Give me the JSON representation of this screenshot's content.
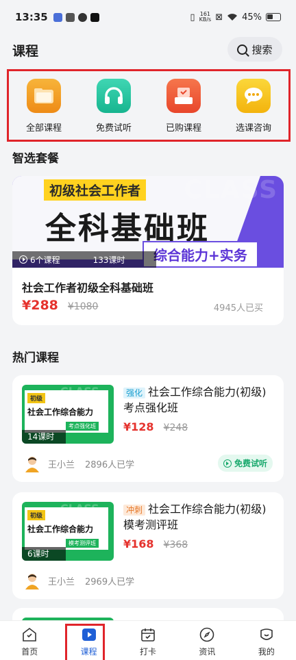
{
  "status_bar": {
    "time": "13:35",
    "net_speed_value": "161",
    "net_speed_unit": "KB/s",
    "battery": "45%"
  },
  "header": {
    "title": "课程",
    "search_label": "搜索"
  },
  "quick_actions": [
    {
      "label": "全部课程",
      "icon": "folder-icon",
      "color": "#f29a1f"
    },
    {
      "label": "免费试听",
      "icon": "headphones-icon",
      "color": "#21c5a2"
    },
    {
      "label": "已购课程",
      "icon": "purchased-box-icon",
      "color": "#ef5e3a"
    },
    {
      "label": "选课咨询",
      "icon": "chat-bubble-icon",
      "color": "#f6c21c"
    }
  ],
  "featured": {
    "section_title": "智选套餐",
    "banner": {
      "tag": "初级社会工作者",
      "title": "全科基础班",
      "subtitle": "综合能力+实务",
      "watermark": "CLASS",
      "course_count": "6个课程",
      "lesson_count": "133课时"
    },
    "name": "社会工作者初级全科基础班",
    "price": "¥288",
    "original_price": "¥1080",
    "buyers": "4945人已买"
  },
  "hot": {
    "section_title": "热门课程",
    "courses": [
      {
        "thumb_badge": "初级",
        "thumb_title": "社会工作综合能力",
        "thumb_sub": "考点强化班",
        "thumb_lessons": "14课时",
        "tag": "强化",
        "title": "社会工作综合能力(初级)考点强化班",
        "price": "¥128",
        "original_price": "¥248",
        "teacher": "王小兰",
        "learners": "2896人已学",
        "free_label": "免费试听"
      },
      {
        "thumb_badge": "初级",
        "thumb_title": "社会工作综合能力",
        "thumb_sub": "模考测评班",
        "thumb_lessons": "6课时",
        "tag": "冲刺",
        "title": "社会工作综合能力(初级)模考测评班",
        "price": "¥168",
        "original_price": "¥368",
        "teacher": "王小兰",
        "learners": "2969人已学"
      }
    ]
  },
  "tabbar": [
    {
      "label": "首页",
      "icon": "home-icon"
    },
    {
      "label": "课程",
      "icon": "course-play-icon",
      "active": true
    },
    {
      "label": "打卡",
      "icon": "calendar-checkin-icon"
    },
    {
      "label": "资讯",
      "icon": "compass-icon"
    },
    {
      "label": "我的",
      "icon": "profile-icon"
    }
  ],
  "colors": {
    "accent_red": "#e5322d",
    "highlight_box": "#e0242a",
    "active_tab": "#1f5fd6"
  }
}
